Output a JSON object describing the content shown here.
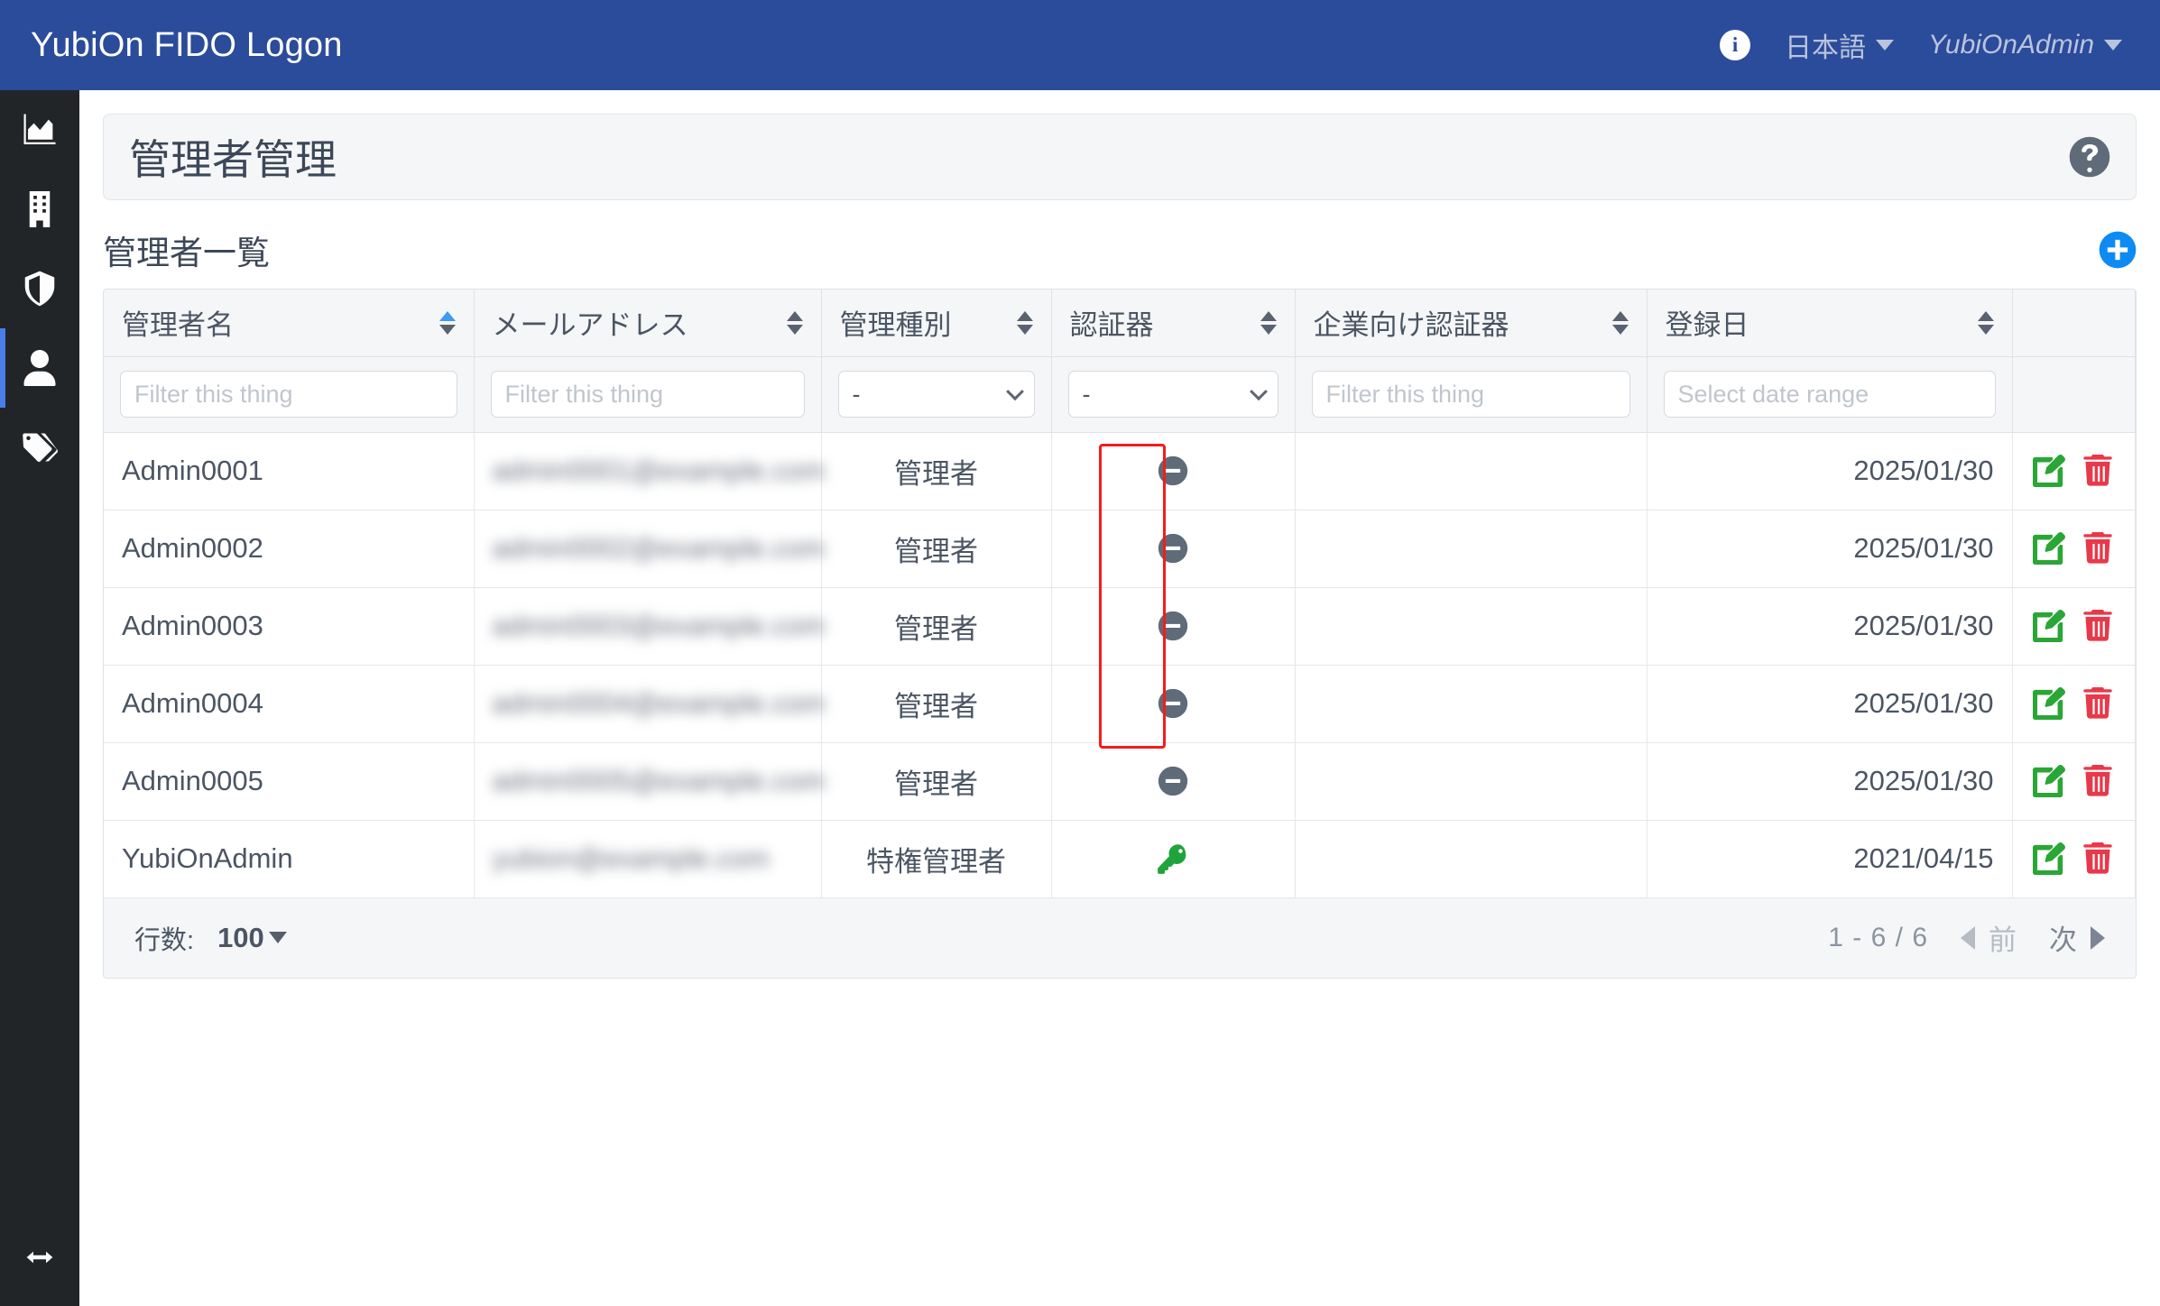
{
  "navbar": {
    "brand": "YubiOn FIDO Logon",
    "info_icon": "info-circle-icon",
    "language": "日本語",
    "user": "YubiOnAdmin"
  },
  "sidebar": {
    "items": [
      {
        "icon": "chart-area-icon",
        "active": false
      },
      {
        "icon": "building-icon",
        "active": false
      },
      {
        "icon": "shield-half-icon",
        "active": false
      },
      {
        "icon": "user-icon",
        "active": true
      },
      {
        "icon": "tags-icon",
        "active": false
      }
    ],
    "toggle_icon": "arrows-left-right-icon"
  },
  "page": {
    "title": "管理者管理",
    "help_icon": "question-circle-icon",
    "section_title": "管理者一覧",
    "add_icon": "plus-circle-icon"
  },
  "table": {
    "columns": [
      {
        "label": "管理者名",
        "sort": "asc"
      },
      {
        "label": "メールアドレス",
        "sort": "none"
      },
      {
        "label": "管理種別",
        "sort": "none"
      },
      {
        "label": "認証器",
        "sort": "none"
      },
      {
        "label": "企業向け認証器",
        "sort": "none"
      },
      {
        "label": "登録日",
        "sort": "none"
      },
      {
        "label": "",
        "sort": null
      }
    ],
    "filters": {
      "name_placeholder": "Filter this thing",
      "email_placeholder": "Filter this thing",
      "type_value": "-",
      "authenticator_value": "-",
      "enterprise_placeholder": "Filter this thing",
      "date_placeholder": "Select date range"
    },
    "rows": [
      {
        "name": "Admin0001",
        "email": "admin0001@example.com",
        "type": "管理者",
        "authenticator": "minus-circle-icon",
        "enterprise": "",
        "date": "2025/01/30"
      },
      {
        "name": "Admin0002",
        "email": "admin0002@example.com",
        "type": "管理者",
        "authenticator": "minus-circle-icon",
        "enterprise": "",
        "date": "2025/01/30"
      },
      {
        "name": "Admin0003",
        "email": "admin0003@example.com",
        "type": "管理者",
        "authenticator": "minus-circle-icon",
        "enterprise": "",
        "date": "2025/01/30"
      },
      {
        "name": "Admin0004",
        "email": "admin0004@example.com",
        "type": "管理者",
        "authenticator": "minus-circle-icon",
        "enterprise": "",
        "date": "2025/01/30"
      },
      {
        "name": "Admin0005",
        "email": "admin0005@example.com",
        "type": "管理者",
        "authenticator": "minus-circle-icon",
        "enterprise": "",
        "date": "2025/01/30"
      },
      {
        "name": "YubiOnAdmin",
        "email": "yubion@example.com",
        "type": "特権管理者",
        "authenticator": "key-icon",
        "enterprise": "",
        "date": "2021/04/15"
      }
    ],
    "row_actions": {
      "edit_icon": "pen-to-square-icon",
      "delete_icon": "trash-icon"
    }
  },
  "footer": {
    "rows_label": "行数:",
    "rows_value": "100",
    "page_count": "1 - 6 / 6",
    "prev_label": "前",
    "next_label": "次"
  },
  "colors": {
    "navbar_bg": "#2b4b9b",
    "sidebar_bg": "#222528",
    "accent_blue": "#1a8cff",
    "highlight_red": "#f41c1c",
    "edit_green": "#2aa636",
    "delete_red": "#e8394a",
    "key_green": "#21a33c",
    "minus_gray": "#5f6b78"
  }
}
